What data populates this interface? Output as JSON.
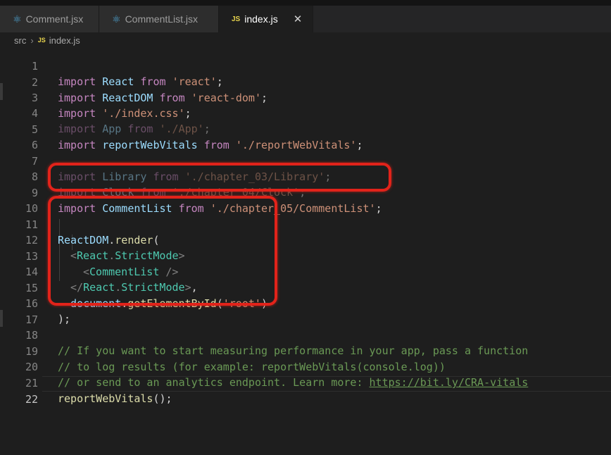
{
  "tabs": [
    {
      "label": "Comment.jsx",
      "icon": "react-icon",
      "active": false
    },
    {
      "label": "CommentList.jsx",
      "icon": "react-icon",
      "active": false
    },
    {
      "label": "index.js",
      "icon": "js-file-icon",
      "active": true,
      "close": "✕"
    }
  ],
  "breadcrumb": {
    "folder": "src",
    "separator": "›",
    "file_icon": "JS",
    "file": "index.js"
  },
  "editor": {
    "current_line": 22,
    "lines": [
      {
        "n": "1"
      },
      {
        "n": "2"
      },
      {
        "n": "3"
      },
      {
        "n": "4"
      },
      {
        "n": "5"
      },
      {
        "n": "6"
      },
      {
        "n": "7"
      },
      {
        "n": "8"
      },
      {
        "n": "9"
      },
      {
        "n": "10"
      },
      {
        "n": "11"
      },
      {
        "n": "12"
      },
      {
        "n": "13"
      },
      {
        "n": "14"
      },
      {
        "n": "15"
      },
      {
        "n": "16"
      },
      {
        "n": "17"
      },
      {
        "n": "18"
      },
      {
        "n": "19"
      },
      {
        "n": "20"
      },
      {
        "n": "21"
      },
      {
        "n": "22"
      }
    ],
    "tokens": {
      "l1_kw": "import",
      "l1_id": " React",
      "l1_from": " from ",
      "l1_str": "'react'",
      "l1_end": ";",
      "l2_kw": "import",
      "l2_id": " ReactDOM",
      "l2_from": " from ",
      "l2_str": "'react-dom'",
      "l2_end": ";",
      "l3_kw": "import",
      "l3_str": " './index.css'",
      "l3_end": ";",
      "l4_kw": "import",
      "l4_id": " App",
      "l4_from": " from ",
      "l4_str": "'./App'",
      "l4_end": ";",
      "l5_kw": "import",
      "l5_id": " reportWebVitals",
      "l5_from": " from ",
      "l5_str": "'./reportWebVitals'",
      "l5_end": ";",
      "l7_kw": "import",
      "l7_id": " Library",
      "l7_from": " from ",
      "l7_str": "'./chapter_03/Library'",
      "l7_end": ";",
      "l8_kw": "import",
      "l8_id": " Clock",
      "l8_from": " from ",
      "l8_str": "'./chapter_04/Clock'",
      "l8_end": ";",
      "l9_kw": "import",
      "l9_id": " CommentList",
      "l9_from": " from ",
      "l9_str": "'./chapter_05/CommentList'",
      "l9_end": ";",
      "l11_id": "ReactDOM",
      "l11_dot": ".",
      "l11_fn": "render",
      "l11_end": "(",
      "l12_open": "<",
      "l12_tag1": "React",
      "l12_dot": ".",
      "l12_tag2": "StrictMode",
      "l12_close": ">",
      "l13_open": "<",
      "l13_tag": "CommentList",
      "l13_close": " />",
      "l14_open": "</",
      "l14_tag1": "React",
      "l14_dot": ".",
      "l14_tag2": "StrictMode",
      "l14_close": ">",
      "l14_end": ",",
      "l15_id": "document",
      "l15_dot": ".",
      "l15_fn": "getElementById",
      "l15_p1": "(",
      "l15_str": "'root'",
      "l15_p2": ")",
      "l16_end": ");",
      "l18_cm": "// If you want to start measuring performance in your app, pass a function",
      "l19_cm": "// to log results (for example: reportWebVitals(console.log))",
      "l20_cm": "// or send to an analytics endpoint. Learn more: ",
      "l20_link": "https://bit.ly/CRA-vitals",
      "l21_fn": "reportWebVitals",
      "l21_end": "();"
    }
  },
  "colors": {
    "annotation": "#e2231a",
    "background": "#1e1e1e",
    "keyword": "#c586c0",
    "string": "#ce9178",
    "identifier": "#9cdcfe",
    "function": "#dcdcaa",
    "tag": "#4ec9b0",
    "comment": "#6a9955"
  }
}
